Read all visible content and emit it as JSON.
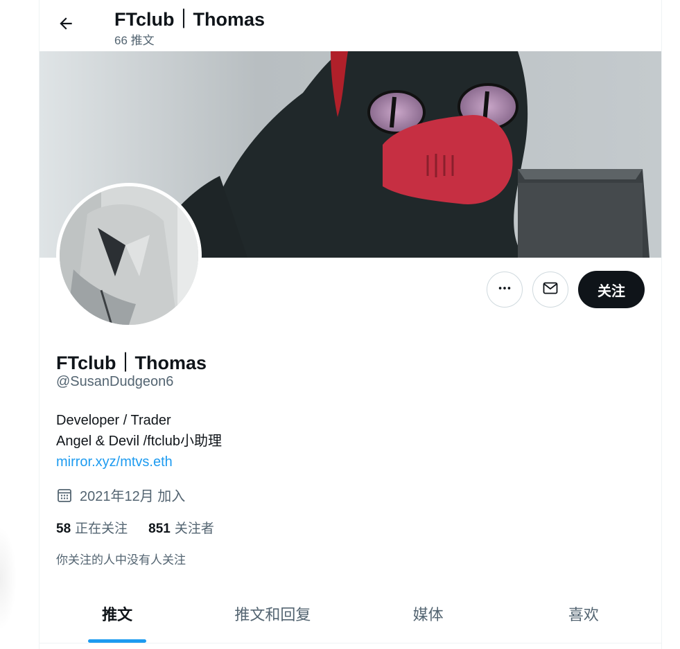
{
  "header": {
    "title": "FTclub｜Thomas",
    "tweet_count": "66 推文"
  },
  "profile": {
    "name": "FTclub｜Thomas",
    "handle": "@SusanDudgeon6",
    "bio_lines": [
      "Developer / Trader",
      "Angel & Devil /ftclub小助理"
    ],
    "link": "mirror.xyz/mtvs.eth",
    "joined": "2021年12月 加入",
    "following_count": "58",
    "following_label": "正在关注",
    "followers_count": "851",
    "followers_label": "关注者",
    "mutuals_note": "你关注的人中没有人关注"
  },
  "actions": {
    "follow_label": "关注"
  },
  "tabs": [
    {
      "label": "推文",
      "active": true
    },
    {
      "label": "推文和回复",
      "active": false
    },
    {
      "label": "媒体",
      "active": false
    },
    {
      "label": "喜欢",
      "active": false
    }
  ],
  "colors": {
    "accent": "#1d9bf0",
    "text_primary": "#0f1419",
    "text_secondary": "#536471",
    "follow_button_bg": "#0f1419"
  },
  "icons": {
    "back": "arrow-left-icon",
    "more": "more-horizontal-icon",
    "message": "mail-icon",
    "joined": "calendar-icon"
  }
}
